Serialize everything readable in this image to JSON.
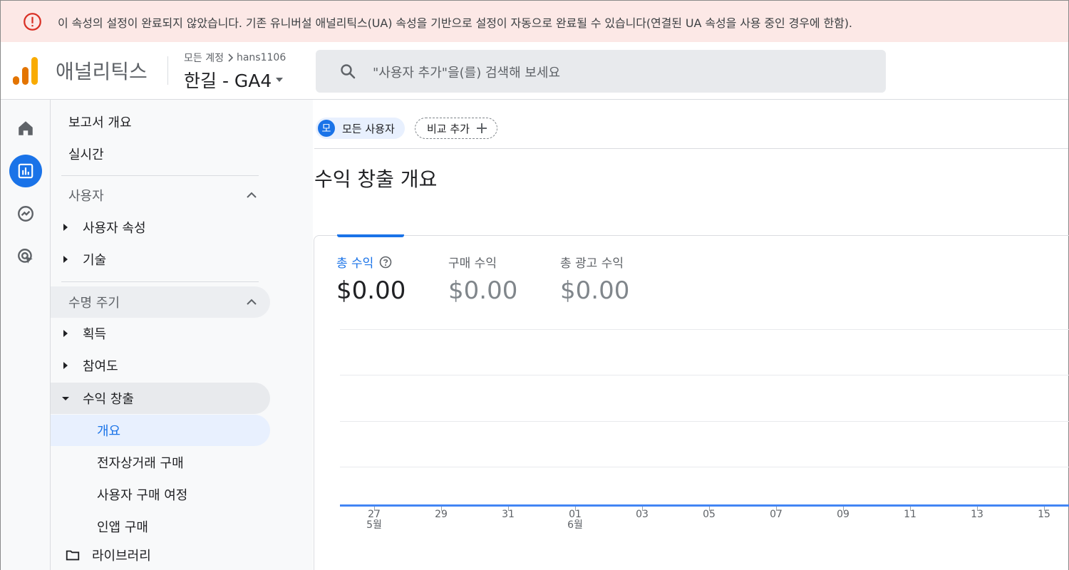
{
  "banner": {
    "message": "이 속성의 설정이 완료되지 않았습니다. 기존 유니버설 애널리틱스(UA) 속성을 기반으로 설정이 자동으로 완료될 수 있습니다(연결된 UA 속성을 사용 중인 경우에 한함).",
    "icon": "error-icon",
    "color": "#d93025"
  },
  "header": {
    "app_name": "애널리틱스",
    "breadcrumb_root": "모든 계정",
    "breadcrumb_account": "hans1106",
    "property_name": "한길 - GA4",
    "search_placeholder": "\"사용자 추가\"을(를) 검색해 보세요"
  },
  "nav": {
    "reports_snapshot": "보고서 개요",
    "realtime": "실시간",
    "user_section": "사용자",
    "user_attributes": "사용자 속성",
    "tech": "기술",
    "lifecycle_section": "수명 주기",
    "acquisition": "획득",
    "engagement": "참여도",
    "monetization": "수익 창출",
    "monetization_children": [
      "개요",
      "전자상거래 구매",
      "사용자 구매 여정",
      "인앱 구매"
    ],
    "library": "라이브러리"
  },
  "main": {
    "segment_avatar": "모",
    "segment_label": "모든 사용자",
    "add_comparison": "비교 추가",
    "page_title": "수익 창출 개요",
    "metrics": [
      {
        "label": "총 수익",
        "value": "$0.00"
      },
      {
        "label": "구매 수익",
        "value": "$0.00"
      },
      {
        "label": "총 광고 수익",
        "value": "$0.00"
      }
    ]
  },
  "chart_data": {
    "type": "line",
    "x": [
      "27",
      "29",
      "31",
      "01",
      "03",
      "05",
      "07",
      "09",
      "11",
      "13",
      "15"
    ],
    "x_month_labels": {
      "27": "5월",
      "01": "6월"
    },
    "series": [
      {
        "values": [
          0,
          0,
          0,
          0,
          0,
          0,
          0,
          0,
          0,
          0,
          0
        ]
      }
    ],
    "series_color": "#4285f4",
    "grid": true
  }
}
